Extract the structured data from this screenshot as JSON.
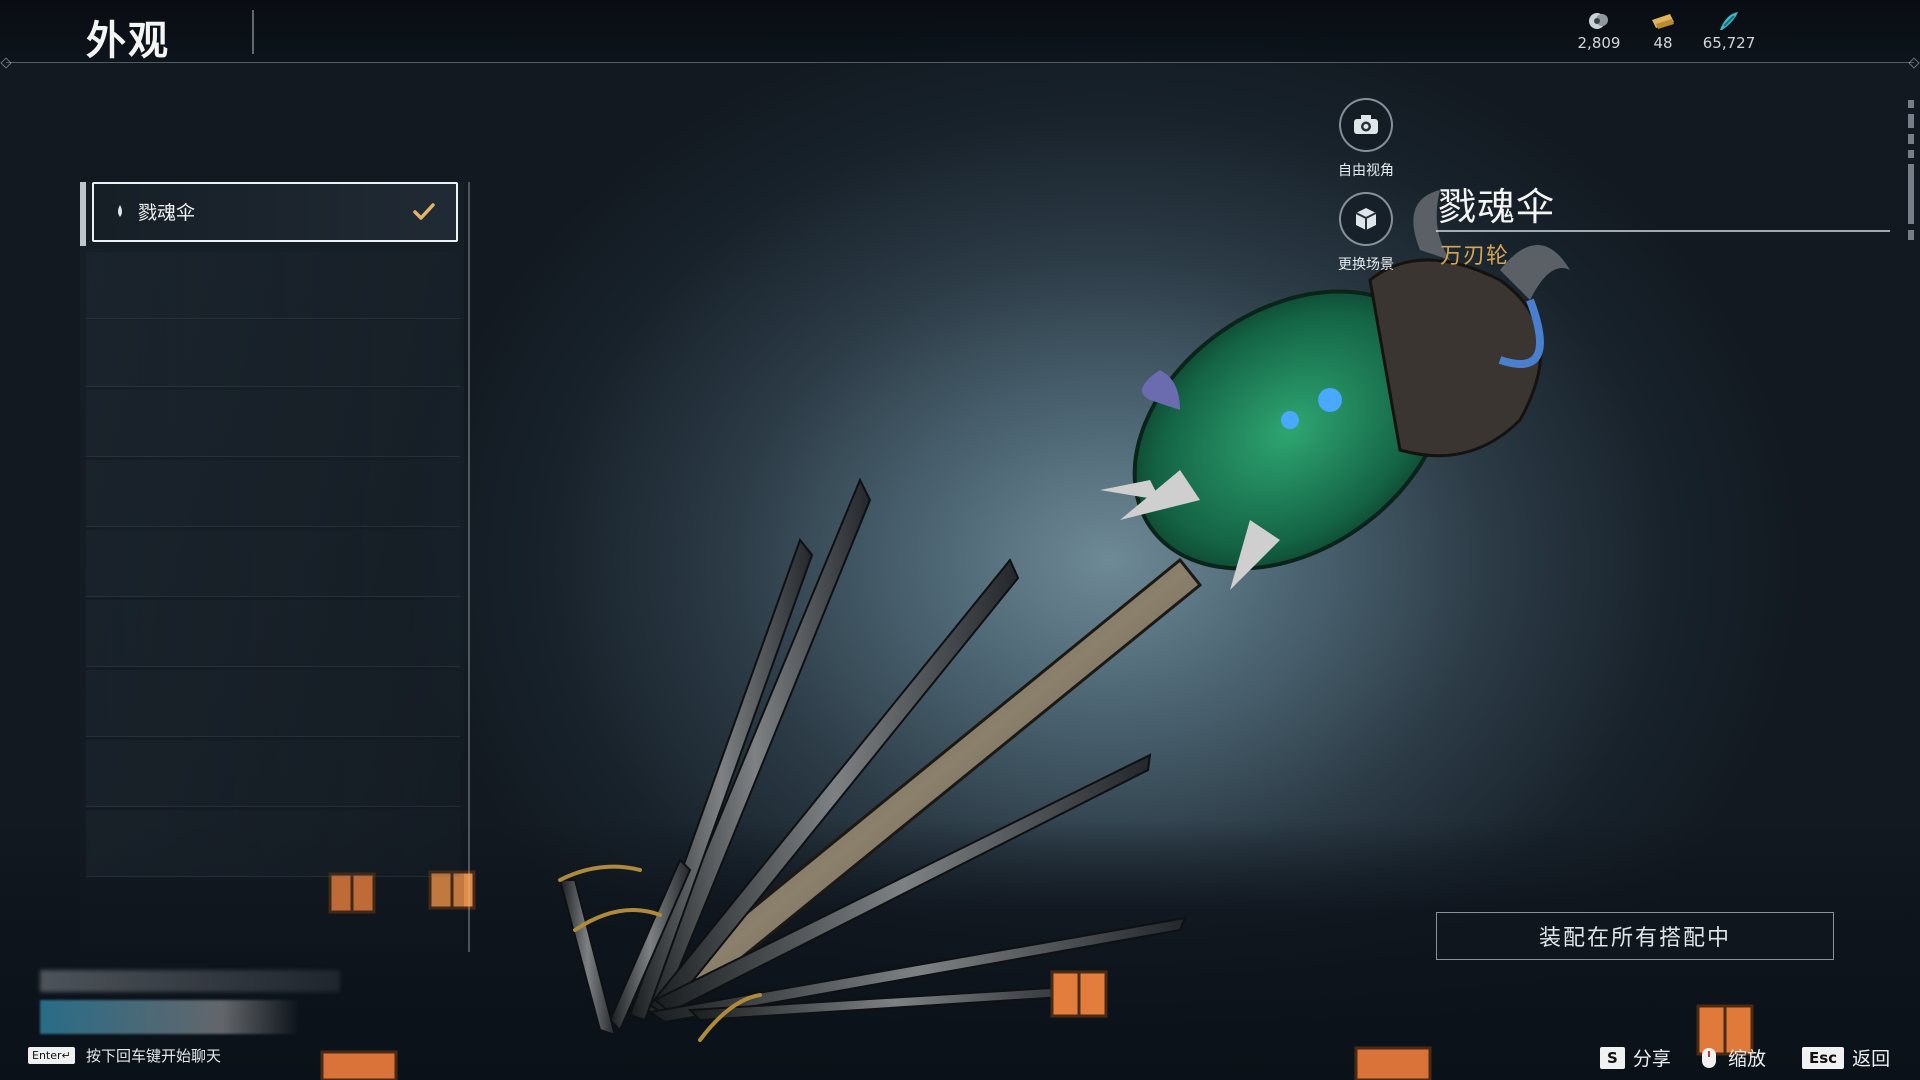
{
  "header": {
    "title": "外观",
    "currencies": [
      {
        "icon": "spirit-coin-icon",
        "value": "2,809",
        "color": "#c9d2d8"
      },
      {
        "icon": "gold-ticket-icon",
        "value": "48",
        "color": "#e0b45a"
      },
      {
        "icon": "jade-feather-icon",
        "value": "65,727",
        "color": "#3fb7c9"
      }
    ]
  },
  "list": {
    "selected_item": "戮魂伞",
    "selected_checked": true
  },
  "controls": {
    "free_view_label": "自由视角",
    "change_scene_label": "更换场景"
  },
  "item": {
    "name": "戮魂伞",
    "subtitle": "万刃轮"
  },
  "equip_button_label": "装配在所有搭配中",
  "footer": {
    "chat_key": "Enter↵",
    "chat_hint": "按下回车键开始聊天",
    "share_key": "S",
    "share_label": "分享",
    "zoom_label": "缩放",
    "back_key": "Esc",
    "back_label": "返回"
  },
  "colors": {
    "accent_gold": "#d8a552",
    "dragon_green": "#1f7a54"
  }
}
